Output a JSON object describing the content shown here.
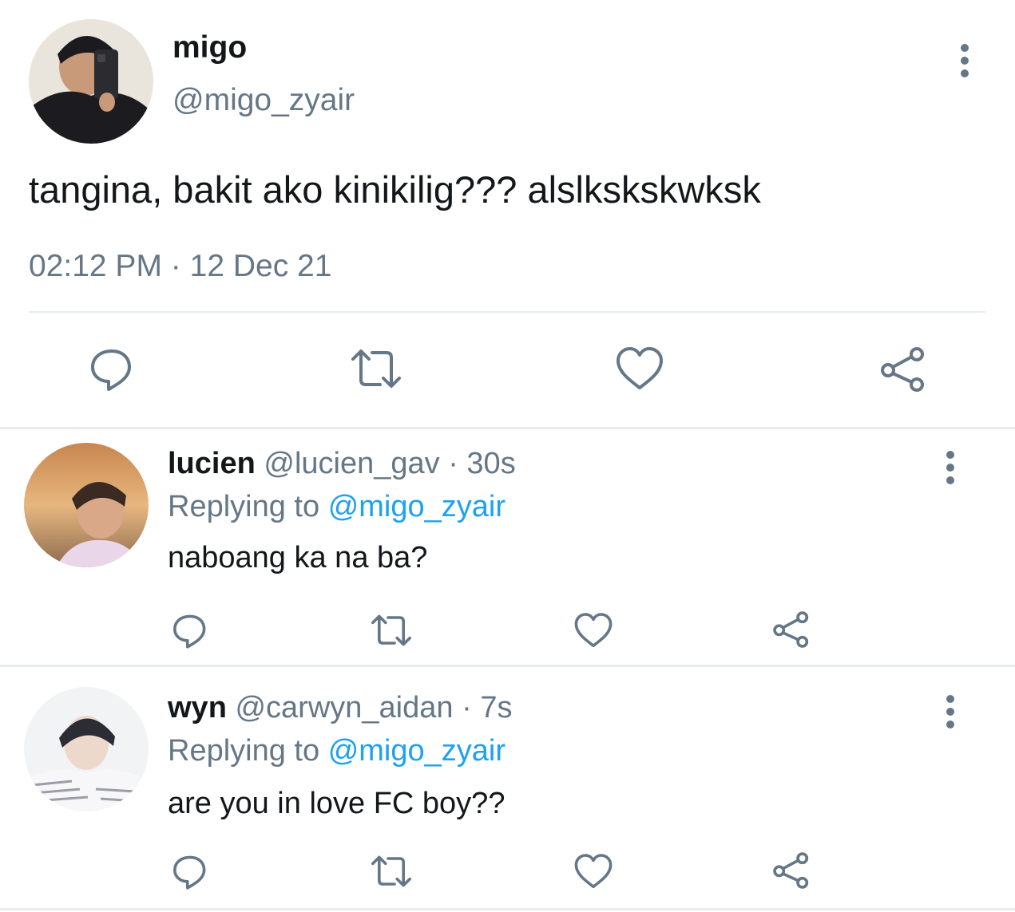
{
  "tweet": {
    "name": "migo",
    "handle": "@migo_zyair",
    "text": "tangina, bakit ako kinikilig??? alslkskskwksk",
    "time": "02:12 PM",
    "date_sep": "·",
    "date": "12 Dec 21"
  },
  "replies": [
    {
      "name": "lucien",
      "handle": "@lucien_gav",
      "sep": "·",
      "time": "30s",
      "replying_label": "Replying to",
      "replying_to": "@migo_zyair",
      "text": "naboang ka na ba?"
    },
    {
      "name": "wyn",
      "handle": "@carwyn_aidan",
      "sep": "·",
      "time": "7s",
      "replying_label": "Replying to",
      "replying_to": "@migo_zyair",
      "text": "are you in love FC boy??"
    }
  ],
  "icons": {
    "actions": [
      "comment-icon",
      "retweet-icon",
      "like-icon",
      "share-icon"
    ],
    "menu": "more-vertical-icon"
  },
  "colors": {
    "text": "#14171a",
    "muted": "#657786",
    "link": "#1da1f2",
    "divider": "#e6ecf0"
  }
}
